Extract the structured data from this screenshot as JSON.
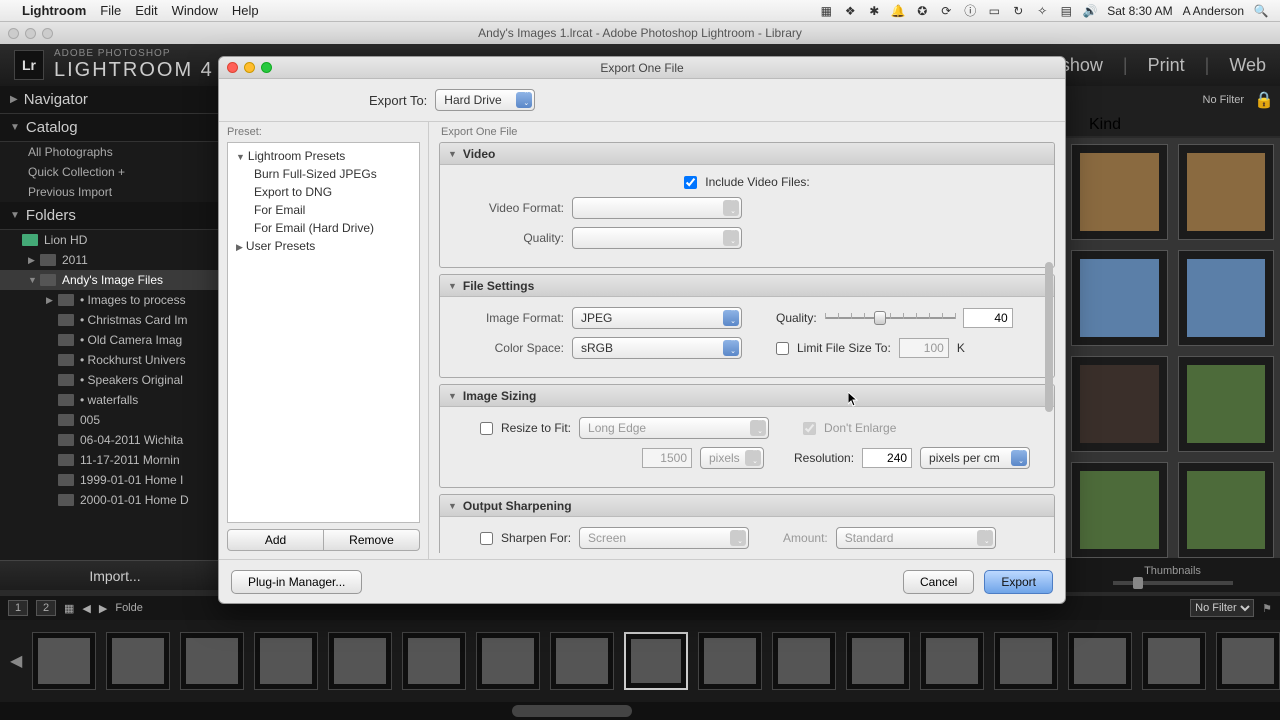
{
  "menubar": {
    "app": "Lightroom",
    "items": [
      "File",
      "Edit",
      "Window",
      "Help"
    ],
    "clock": "Sat 8:30 AM",
    "user": "A Anderson"
  },
  "lr_window_title": "Andy's Images 1.lrcat - Adobe Photoshop Lightroom - Library",
  "lr": {
    "brand_top": "ADOBE PHOTOSHOP",
    "brand": "LIGHTROOM 4",
    "modules": {
      "m4": "show",
      "m5": "Print",
      "m6": "Web"
    }
  },
  "left_panel": {
    "navigator": "Navigator",
    "catalog": "Catalog",
    "catalog_items": [
      "All Photographs",
      "Quick Collection  +",
      "Previous Import"
    ],
    "folders": "Folders",
    "drive": "Lion HD",
    "tree": {
      "y2011": "2011",
      "andy": "Andy's Image Files",
      "children": [
        "• Images to process",
        "• Christmas Card Im",
        "• Old Camera Imag",
        "• Rockhurst Univers",
        "• Speakers Original",
        "• waterfalls",
        "005",
        "06-04-2011 Wichita",
        "11-17-2011 Mornin",
        "1999-01-01 Home I",
        "2000-01-01 Home D"
      ]
    },
    "import": "Import..."
  },
  "filmstrip": {
    "page1": "1",
    "page2": "2",
    "folder": "Folde",
    "nofilter": "No Filter"
  },
  "right_bar": {
    "nofilter": "No Filter",
    "kind": "Kind",
    "thumbs": "Thumbnails"
  },
  "dialog": {
    "title": "Export One File",
    "export_to_label": "Export To:",
    "export_to_value": "Hard Drive",
    "preset_label": "Preset:",
    "settings_label": "Export One File",
    "presets": {
      "group1": "Lightroom Presets",
      "items": [
        "Burn Full-Sized JPEGs",
        "Export to DNG",
        "For Email",
        "For Email (Hard Drive)"
      ],
      "group2": "User Presets"
    },
    "add": "Add",
    "remove": "Remove",
    "sections": {
      "video": {
        "title": "Video",
        "include": "Include Video Files:",
        "format_label": "Video Format:",
        "quality_label": "Quality:"
      },
      "file_settings": {
        "title": "File Settings",
        "image_format_label": "Image Format:",
        "image_format": "JPEG",
        "quality_label": "Quality:",
        "quality_value": "40",
        "color_space_label": "Color Space:",
        "color_space": "sRGB",
        "limit_label": "Limit File Size To:",
        "limit_value": "100",
        "limit_unit": "K"
      },
      "image_sizing": {
        "title": "Image Sizing",
        "resize_label": "Resize to Fit:",
        "resize_mode": "Long Edge",
        "dont_enlarge": "Don't Enlarge",
        "size_value": "1500",
        "size_unit": "pixels",
        "resolution_label": "Resolution:",
        "resolution_value": "240",
        "resolution_unit": "pixels per cm"
      },
      "output_sharpening": {
        "title": "Output Sharpening",
        "sharpen_label": "Sharpen For:",
        "sharpen_for": "Screen",
        "amount_label": "Amount:",
        "amount": "Standard"
      }
    },
    "plugin": "Plug-in Manager...",
    "cancel": "Cancel",
    "export": "Export"
  }
}
